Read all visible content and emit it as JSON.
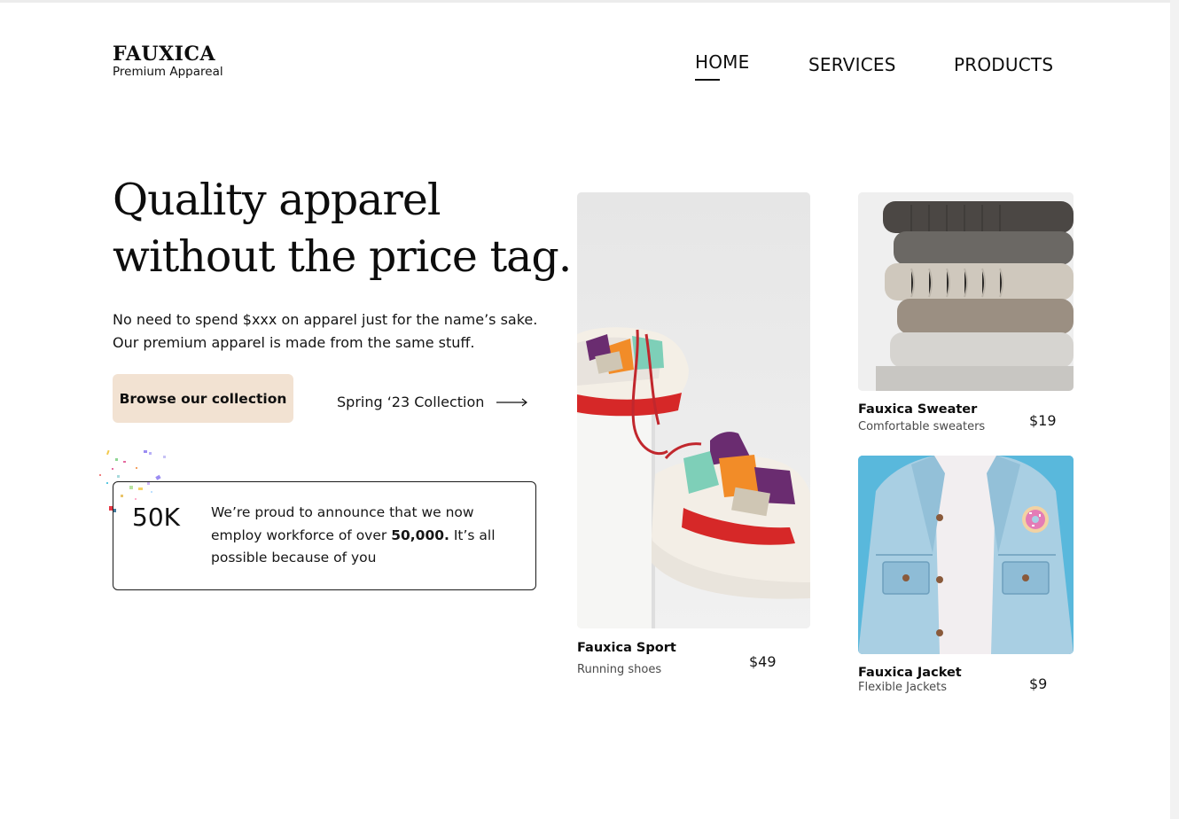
{
  "brand": {
    "name": "FAUXICA",
    "tagline": "Premium Appareal"
  },
  "nav": {
    "items": [
      {
        "label": "HOME",
        "active": true
      },
      {
        "label": "SERVICES",
        "active": false
      },
      {
        "label": "PRODUCTS",
        "active": false
      }
    ]
  },
  "hero": {
    "title_line1": "Quality apparel",
    "title_line2": "without the price tag.",
    "desc_line1": "No need to spend $xxx on apparel just for the name’s sake.",
    "desc_line2": "Our premium apparel is made from the same stuff.",
    "browse_label": "Browse our collection",
    "collection_label": "Spring ‘23 Collection"
  },
  "stat": {
    "number": "50K",
    "text_before": "We’re proud to announce that we now employ workforce of over ",
    "text_bold": "50,000.",
    "text_after": " It’s all possible because of you"
  },
  "products": [
    {
      "name": "Fauxica Sport",
      "subtitle": "Running shoes",
      "price": "$49",
      "image": "sneakers-photo"
    },
    {
      "name": "Fauxica Sweater",
      "subtitle": "Comfortable sweaters",
      "price": "$19",
      "image": "sweaters-photo"
    },
    {
      "name": "Fauxica Jacket",
      "subtitle": "Flexible Jackets",
      "price": "$9",
      "image": "denim-jacket-photo"
    }
  ],
  "colors": {
    "button_bg": "#f2e2d2",
    "text": "#0d0d0d",
    "jacket_bg": "#5bb9dd"
  }
}
